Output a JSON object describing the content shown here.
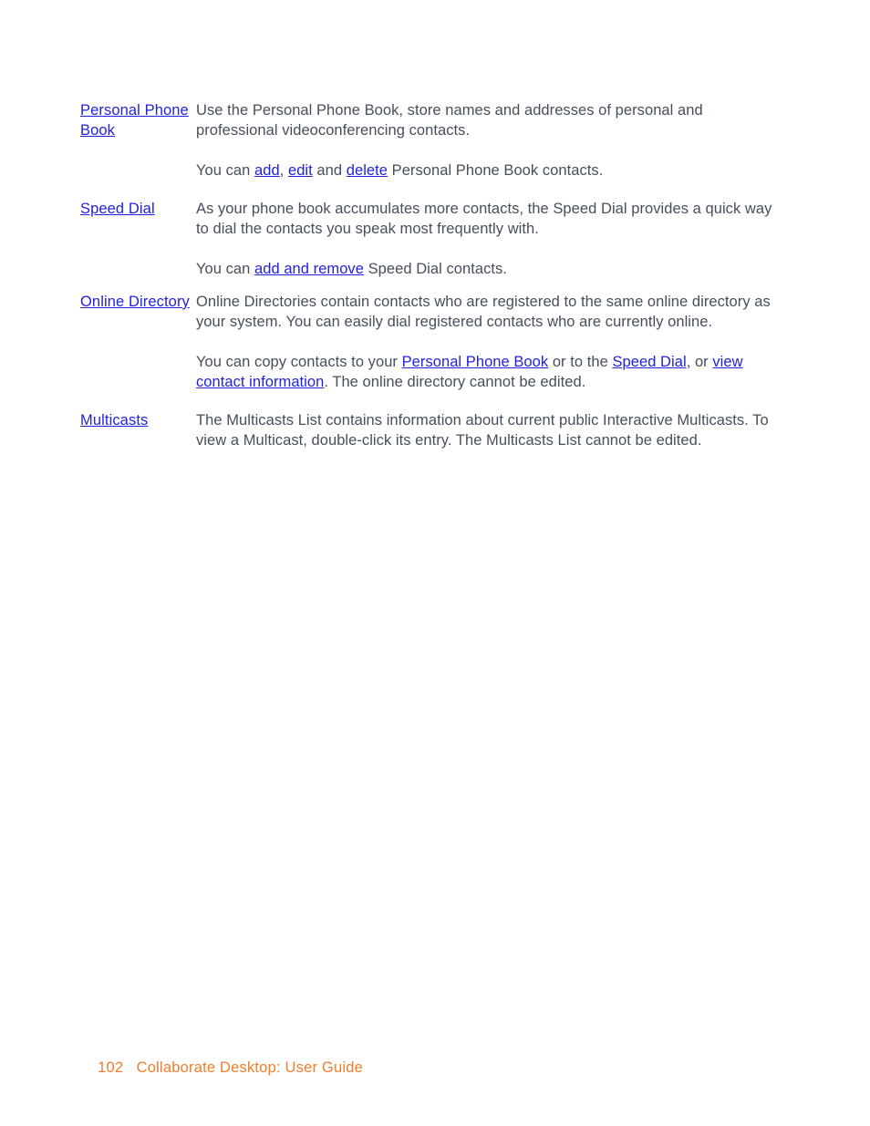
{
  "document": {
    "entries": [
      {
        "term": "Personal Phone Book",
        "paragraphs": [
          {
            "runs": [
              {
                "type": "text",
                "text": "Use the Personal Phone Book, store names and addresses of personal and professional videoconferencing contacts."
              }
            ]
          },
          {
            "runs": [
              {
                "type": "text",
                "text": "You can "
              },
              {
                "type": "link",
                "text": "add"
              },
              {
                "type": "text",
                "text": ", "
              },
              {
                "type": "link",
                "text": "edit"
              },
              {
                "type": "text",
                "text": " and "
              },
              {
                "type": "link",
                "text": "delete"
              },
              {
                "type": "text",
                "text": " Personal Phone Book contacts."
              }
            ]
          }
        ]
      },
      {
        "term": "Speed Dial",
        "paragraphs": [
          {
            "runs": [
              {
                "type": "text",
                "text": "As your phone book accumulates more contacts, the Speed Dial provides a quick way to dial the contacts you speak most frequently with."
              }
            ]
          },
          {
            "runs": [
              {
                "type": "text",
                "text": "You can "
              },
              {
                "type": "link",
                "text": "add and remove"
              },
              {
                "type": "text",
                "text": " Speed Dial contacts."
              }
            ]
          }
        ]
      },
      {
        "term": "Online Directory",
        "paragraphs": [
          {
            "runs": [
              {
                "type": "text",
                "text": "Online Directories contain contacts who are registered to the same online directory as your system. You can easily dial registered contacts who are currently online."
              }
            ]
          },
          {
            "runs": [
              {
                "type": "text",
                "text": "You can copy contacts to your "
              },
              {
                "type": "link",
                "text": "Personal Phone Book"
              },
              {
                "type": "text",
                "text": " or to the "
              },
              {
                "type": "link",
                "text": "Speed Dial"
              },
              {
                "type": "text",
                "text": ", or "
              },
              {
                "type": "link",
                "text": "view contact information"
              },
              {
                "type": "text",
                "text": ". The online directory cannot be edited."
              }
            ]
          }
        ]
      },
      {
        "term": "Multicasts",
        "paragraphs": [
          {
            "runs": [
              {
                "type": "text",
                "text": "The Multicasts List contains information about current public Interactive Multicasts. To view a Multicast, double-click its entry. The Multicasts List cannot be edited."
              }
            ]
          }
        ]
      }
    ]
  },
  "footer": {
    "page_number": "102",
    "separator": "   ",
    "doc_title": "Collaborate Desktop: User Guide"
  },
  "colors": {
    "link": "#2222dd",
    "body_text": "#464f5c",
    "footer": "#f07d2c",
    "background": "#ffffff"
  }
}
